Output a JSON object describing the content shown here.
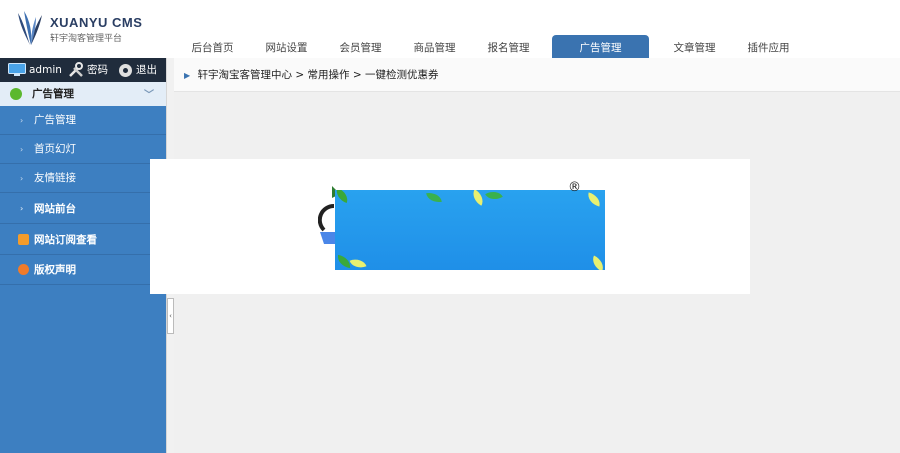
{
  "brand": {
    "name": "XUANYU CMS",
    "tagline": "轩宇淘客管理平台"
  },
  "nav": {
    "tabs": [
      {
        "label": "后台首页",
        "active": false
      },
      {
        "label": "网站设置",
        "active": false
      },
      {
        "label": "会员管理",
        "active": false
      },
      {
        "label": "商品管理",
        "active": false
      },
      {
        "label": "报名管理",
        "active": false
      },
      {
        "label": "广告管理",
        "active": true
      },
      {
        "label": "文章管理",
        "active": false
      },
      {
        "label": "插件应用",
        "active": false
      }
    ]
  },
  "user": {
    "name": "admin",
    "password_label": "密码",
    "logout_label": "退出"
  },
  "sidebar": {
    "section_title": "广告管理",
    "items": [
      {
        "label": "广告管理"
      },
      {
        "label": "首页幻灯"
      },
      {
        "label": "友情链接"
      }
    ],
    "site_front": "网站前台",
    "rss": "网站订阅查看",
    "copyright": "版权声明"
  },
  "breadcrumb": {
    "root": "轩宇淘宝客管理中心",
    "sep1": " > ",
    "mid": "常用操作",
    "sep2": " > ",
    "current": "一键检测优惠券"
  },
  "popup": {
    "registered_mark": "®"
  },
  "colors": {
    "sidebar": "#3d7fc1",
    "active_tab": "#3a73b0",
    "userbar": "#202c3c",
    "banner": "#1f8fe8"
  },
  "icons": [
    "monitor-icon",
    "tools-icon",
    "gear-icon",
    "check-icon",
    "chevron-down-icon",
    "rss-icon",
    "info-icon",
    "collapse-arrow-icon"
  ]
}
